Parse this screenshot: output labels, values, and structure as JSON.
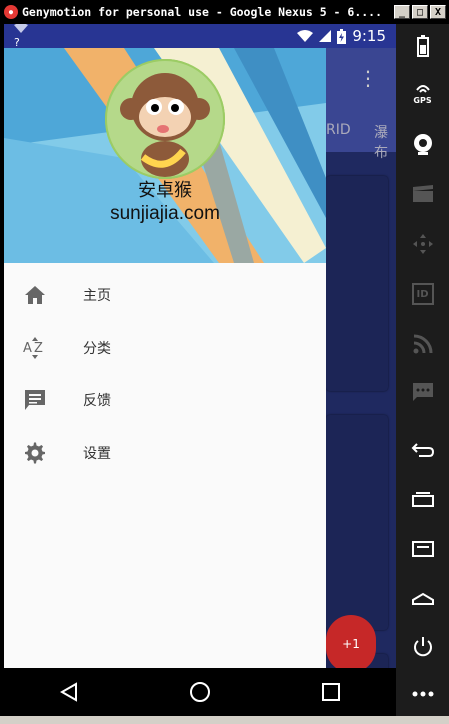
{
  "window": {
    "title": "Genymotion for personal use - Google Nexus 5 - 6....",
    "btn_min": "_",
    "btn_max": "□",
    "btn_close": "X"
  },
  "status_bar": {
    "signal_text": "?",
    "time": "9:15"
  },
  "background_app": {
    "tab_partial_1": "RID",
    "tab_partial_2": "瀑布",
    "fab_label": "+1"
  },
  "drawer": {
    "user_name": "安卓猴",
    "user_site": "sunjiajia.com",
    "menu": [
      {
        "label": "主页",
        "icon": "home-icon"
      },
      {
        "label": "分类",
        "icon": "sort-az-icon"
      },
      {
        "label": "反馈",
        "icon": "feedback-icon"
      },
      {
        "label": "设置",
        "icon": "settings-icon"
      }
    ]
  },
  "side_panel": {
    "gps_label": "GPS",
    "id_label": "ID"
  },
  "colors": {
    "status_bar": "#283593",
    "toolbar": "#3a4692",
    "fab": "#c62828",
    "drawer_bg": "#fafafa"
  }
}
